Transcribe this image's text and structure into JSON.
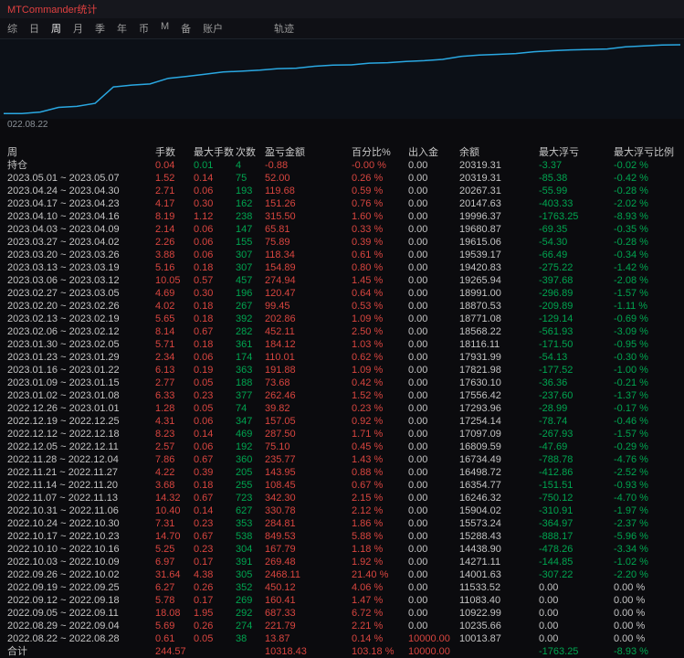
{
  "window": {
    "title": "MTCommander统计"
  },
  "menu": {
    "items": [
      "综",
      "日",
      "周",
      "月",
      "季",
      "年",
      "币",
      "M",
      "备",
      "账户"
    ],
    "active": "周",
    "right_item": "轨迹"
  },
  "chart": {
    "x_label": "022.08.22"
  },
  "chart_data": {
    "type": "line",
    "title": "",
    "xlabel": "",
    "ylabel": "余额",
    "x_tick_labels": [
      "022.08.22"
    ],
    "ylim": [
      9900,
      20450
    ],
    "grid": false,
    "legend": false,
    "line_color": "#2aa8e2",
    "series": [
      {
        "name": "余额",
        "values": [
          10000,
          10013.87,
          10235.66,
          10922.99,
          11083.4,
          11533.52,
          14001.63,
          14271.11,
          14438.9,
          15288.43,
          15573.24,
          15904.02,
          16246.32,
          16354.77,
          16498.72,
          16734.49,
          16809.59,
          17097.09,
          17254.14,
          17293.96,
          17556.42,
          17630.1,
          17821.98,
          17931.99,
          18116.11,
          18568.22,
          18771.08,
          18870.53,
          18991.0,
          19265.94,
          19420.83,
          19539.17,
          19615.06,
          19680.87,
          19996.37,
          20147.63,
          20267.31,
          20319.31
        ]
      }
    ]
  },
  "table": {
    "headers": [
      "周",
      "手数",
      "最大手数",
      "次数",
      "盈亏金额",
      "百分比%",
      "出入金",
      "余额",
      "最大浮亏",
      "最大浮亏比例"
    ],
    "position_row_label": "持仓",
    "total_row_label": "合计",
    "colors": {
      "gain_red": "#d8453f",
      "loss_green": "#00a550",
      "neutral": "#c4c4c4"
    },
    "rows": [
      [
        "持仓",
        "0.04",
        "0.01",
        "4",
        "-0.88",
        "-0.00 %",
        "0.00",
        "20319.31",
        "-3.37",
        "-0.02 %"
      ],
      [
        "2023.05.01 ~ 2023.05.07",
        "1.52",
        "0.14",
        "75",
        "52.00",
        "0.26 %",
        "0.00",
        "20319.31",
        "-85.38",
        "-0.42 %"
      ],
      [
        "2023.04.24 ~ 2023.04.30",
        "2.71",
        "0.06",
        "193",
        "119.68",
        "0.59 %",
        "0.00",
        "20267.31",
        "-55.99",
        "-0.28 %"
      ],
      [
        "2023.04.17 ~ 2023.04.23",
        "4.17",
        "0.30",
        "162",
        "151.26",
        "0.76 %",
        "0.00",
        "20147.63",
        "-403.33",
        "-2.02 %"
      ],
      [
        "2023.04.10 ~ 2023.04.16",
        "8.19",
        "1.12",
        "238",
        "315.50",
        "1.60 %",
        "0.00",
        "19996.37",
        "-1763.25",
        "-8.93 %"
      ],
      [
        "2023.04.03 ~ 2023.04.09",
        "2.14",
        "0.06",
        "147",
        "65.81",
        "0.33 %",
        "0.00",
        "19680.87",
        "-69.35",
        "-0.35 %"
      ],
      [
        "2023.03.27 ~ 2023.04.02",
        "2.26",
        "0.06",
        "155",
        "75.89",
        "0.39 %",
        "0.00",
        "19615.06",
        "-54.30",
        "-0.28 %"
      ],
      [
        "2023.03.20 ~ 2023.03.26",
        "3.88",
        "0.06",
        "307",
        "118.34",
        "0.61 %",
        "0.00",
        "19539.17",
        "-66.49",
        "-0.34 %"
      ],
      [
        "2023.03.13 ~ 2023.03.19",
        "5.16",
        "0.18",
        "307",
        "154.89",
        "0.80 %",
        "0.00",
        "19420.83",
        "-275.22",
        "-1.42 %"
      ],
      [
        "2023.03.06 ~ 2023.03.12",
        "10.05",
        "0.57",
        "457",
        "274.94",
        "1.45 %",
        "0.00",
        "19265.94",
        "-397.68",
        "-2.08 %"
      ],
      [
        "2023.02.27 ~ 2023.03.05",
        "4.69",
        "0.30",
        "196",
        "120.47",
        "0.64 %",
        "0.00",
        "18991.00",
        "-296.89",
        "-1.57 %"
      ],
      [
        "2023.02.20 ~ 2023.02.26",
        "4.02",
        "0.18",
        "267",
        "99.45",
        "0.53 %",
        "0.00",
        "18870.53",
        "-209.89",
        "-1.11 %"
      ],
      [
        "2023.02.13 ~ 2023.02.19",
        "5.65",
        "0.18",
        "392",
        "202.86",
        "1.09 %",
        "0.00",
        "18771.08",
        "-129.14",
        "-0.69 %"
      ],
      [
        "2023.02.06 ~ 2023.02.12",
        "8.14",
        "0.67",
        "282",
        "452.11",
        "2.50 %",
        "0.00",
        "18568.22",
        "-561.93",
        "-3.09 %"
      ],
      [
        "2023.01.30 ~ 2023.02.05",
        "5.71",
        "0.18",
        "361",
        "184.12",
        "1.03 %",
        "0.00",
        "18116.11",
        "-171.50",
        "-0.95 %"
      ],
      [
        "2023.01.23 ~ 2023.01.29",
        "2.34",
        "0.06",
        "174",
        "110.01",
        "0.62 %",
        "0.00",
        "17931.99",
        "-54.13",
        "-0.30 %"
      ],
      [
        "2023.01.16 ~ 2023.01.22",
        "6.13",
        "0.19",
        "363",
        "191.88",
        "1.09 %",
        "0.00",
        "17821.98",
        "-177.52",
        "-1.00 %"
      ],
      [
        "2023.01.09 ~ 2023.01.15",
        "2.77",
        "0.05",
        "188",
        "73.68",
        "0.42 %",
        "0.00",
        "17630.10",
        "-36.36",
        "-0.21 %"
      ],
      [
        "2023.01.02 ~ 2023.01.08",
        "6.33",
        "0.23",
        "377",
        "262.46",
        "1.52 %",
        "0.00",
        "17556.42",
        "-237.60",
        "-1.37 %"
      ],
      [
        "2022.12.26 ~ 2023.01.01",
        "1.28",
        "0.05",
        "74",
        "39.82",
        "0.23 %",
        "0.00",
        "17293.96",
        "-28.99",
        "-0.17 %"
      ],
      [
        "2022.12.19 ~ 2022.12.25",
        "4.31",
        "0.06",
        "347",
        "157.05",
        "0.92 %",
        "0.00",
        "17254.14",
        "-78.74",
        "-0.46 %"
      ],
      [
        "2022.12.12 ~ 2022.12.18",
        "8.23",
        "0.14",
        "469",
        "287.50",
        "1.71 %",
        "0.00",
        "17097.09",
        "-267.93",
        "-1.57 %"
      ],
      [
        "2022.12.05 ~ 2022.12.11",
        "2.57",
        "0.06",
        "192",
        "75.10",
        "0.45 %",
        "0.00",
        "16809.59",
        "-47.69",
        "-0.29 %"
      ],
      [
        "2022.11.28 ~ 2022.12.04",
        "7.86",
        "0.67",
        "360",
        "235.77",
        "1.43 %",
        "0.00",
        "16734.49",
        "-788.78",
        "-4.76 %"
      ],
      [
        "2022.11.21 ~ 2022.11.27",
        "4.22",
        "0.39",
        "205",
        "143.95",
        "0.88 %",
        "0.00",
        "16498.72",
        "-412.86",
        "-2.52 %"
      ],
      [
        "2022.11.14 ~ 2022.11.20",
        "3.68",
        "0.18",
        "255",
        "108.45",
        "0.67 %",
        "0.00",
        "16354.77",
        "-151.51",
        "-0.93 %"
      ],
      [
        "2022.11.07 ~ 2022.11.13",
        "14.32",
        "0.67",
        "723",
        "342.30",
        "2.15 %",
        "0.00",
        "16246.32",
        "-750.12",
        "-4.70 %"
      ],
      [
        "2022.10.31 ~ 2022.11.06",
        "10.40",
        "0.14",
        "627",
        "330.78",
        "2.12 %",
        "0.00",
        "15904.02",
        "-310.91",
        "-1.97 %"
      ],
      [
        "2022.10.24 ~ 2022.10.30",
        "7.31",
        "0.23",
        "353",
        "284.81",
        "1.86 %",
        "0.00",
        "15573.24",
        "-364.97",
        "-2.37 %"
      ],
      [
        "2022.10.17 ~ 2022.10.23",
        "14.70",
        "0.67",
        "538",
        "849.53",
        "5.88 %",
        "0.00",
        "15288.43",
        "-888.17",
        "-5.96 %"
      ],
      [
        "2022.10.10 ~ 2022.10.16",
        "5.25",
        "0.23",
        "304",
        "167.79",
        "1.18 %",
        "0.00",
        "14438.90",
        "-478.26",
        "-3.34 %"
      ],
      [
        "2022.10.03 ~ 2022.10.09",
        "6.97",
        "0.17",
        "391",
        "269.48",
        "1.92 %",
        "0.00",
        "14271.11",
        "-144.85",
        "-1.02 %"
      ],
      [
        "2022.09.26 ~ 2022.10.02",
        "31.64",
        "4.38",
        "305",
        "2468.11",
        "21.40 %",
        "0.00",
        "14001.63",
        "-307.22",
        "-2.20 %"
      ],
      [
        "2022.09.19 ~ 2022.09.25",
        "6.27",
        "0.26",
        "352",
        "450.12",
        "4.06 %",
        "0.00",
        "11533.52",
        "0.00",
        "0.00 %"
      ],
      [
        "2022.09.12 ~ 2022.09.18",
        "5.78",
        "0.17",
        "269",
        "160.41",
        "1.47 %",
        "0.00",
        "11083.40",
        "0.00",
        "0.00 %"
      ],
      [
        "2022.09.05 ~ 2022.09.11",
        "18.08",
        "1.95",
        "292",
        "687.33",
        "6.72 %",
        "0.00",
        "10922.99",
        "0.00",
        "0.00 %"
      ],
      [
        "2022.08.29 ~ 2022.09.04",
        "5.69",
        "0.26",
        "274",
        "221.79",
        "2.21 %",
        "0.00",
        "10235.66",
        "0.00",
        "0.00 %"
      ],
      [
        "2022.08.22 ~ 2022.08.28",
        "0.61",
        "0.05",
        "38",
        "13.87",
        "0.14 %",
        "10000.00",
        "10013.87",
        "0.00",
        "0.00 %"
      ],
      [
        "合计",
        "244.57",
        "",
        "",
        "10318.43",
        "103.18 %",
        "10000.00",
        "",
        "-1763.25",
        "-8.93 %"
      ]
    ]
  }
}
